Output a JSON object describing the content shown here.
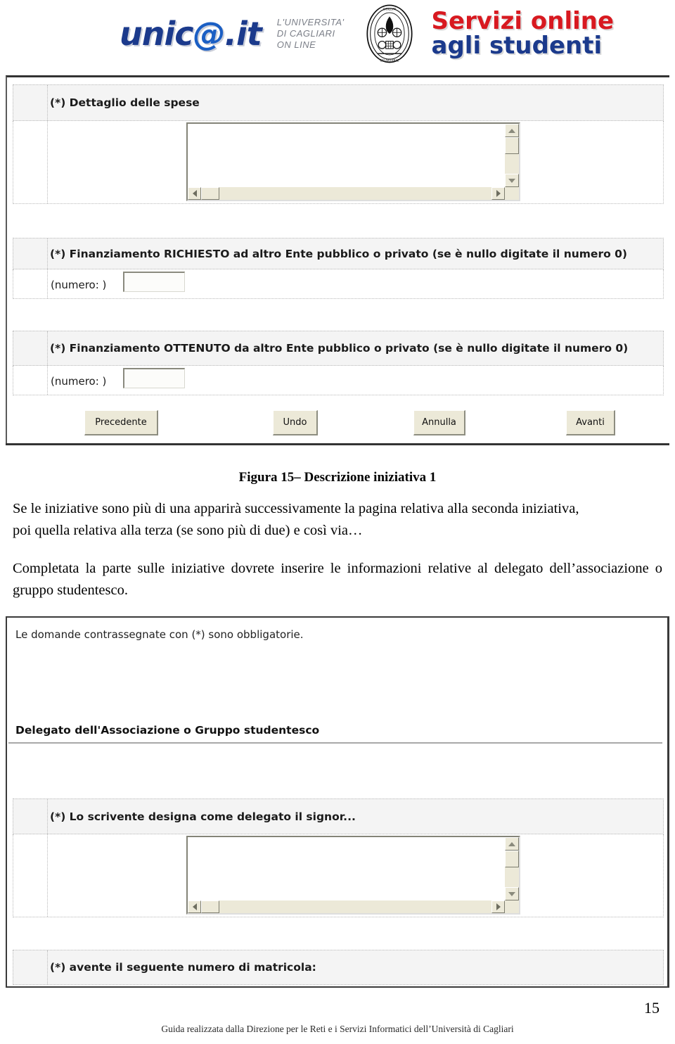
{
  "header": {
    "logo_text": "unic@.it",
    "logo_at": "@",
    "university_line1": "L'UNIVERSITA'",
    "university_line2": "DI CAGLIARI",
    "university_line3": "ON LINE",
    "seal_name": "university-seal",
    "service_line1": "Servizi online",
    "service_line2": "agli studenti",
    "colors": {
      "logo_blue": "#1b3a8c",
      "service_red": "#d81920",
      "service_blue": "#1b3a8c"
    }
  },
  "form_top": {
    "q1": {
      "label": "(*) Dettaglio delle spese",
      "field_type": "textarea",
      "value": ""
    },
    "q2": {
      "label": "(*) Finanziamento RICHIESTO ad altro Ente pubblico o privato (se è nullo digitate il numero 0)",
      "sub_label": "(numero: )",
      "field_type": "text",
      "value": ""
    },
    "q3": {
      "label": "(*) Finanziamento OTTENUTO da altro Ente pubblico o privato (se è nullo digitate il numero 0)",
      "sub_label": "(numero: )",
      "field_type": "text",
      "value": ""
    },
    "buttons": [
      {
        "label": "Precedente"
      },
      {
        "label": "Undo"
      },
      {
        "label": "Annulla"
      },
      {
        "label": "Avanti"
      }
    ]
  },
  "caption": "Figura 15– Descrizione iniziativa 1",
  "body": {
    "p1_line1": "Se le iniziative sono più di una apparirà successivamente la pagina relativa alla seconda iniziativa,",
    "p1_line2": "poi quella relativa alla terza (se sono più di due) e così via…",
    "p2": "Completata la parte sulle iniziative dovrete inserire le informazioni relative al delegato dell’associazione o gruppo studentesco."
  },
  "form_bottom": {
    "note": "Le domande contrassegnate con (*) sono obbligatorie.",
    "section_title": "Delegato dell'Associazione o Gruppo studentesco",
    "q1": {
      "label": "(*) Lo scrivente designa come delegato il signor...",
      "field_type": "textarea",
      "value": ""
    },
    "q2": {
      "label": "(*) avente il seguente numero di matricola:",
      "field_type": "text",
      "value": ""
    }
  },
  "footer": {
    "credit": "Guida realizzata dalla Direzione per le Reti e i Servizi Informatici dell’Università di Cagliari",
    "page_number": "15"
  }
}
